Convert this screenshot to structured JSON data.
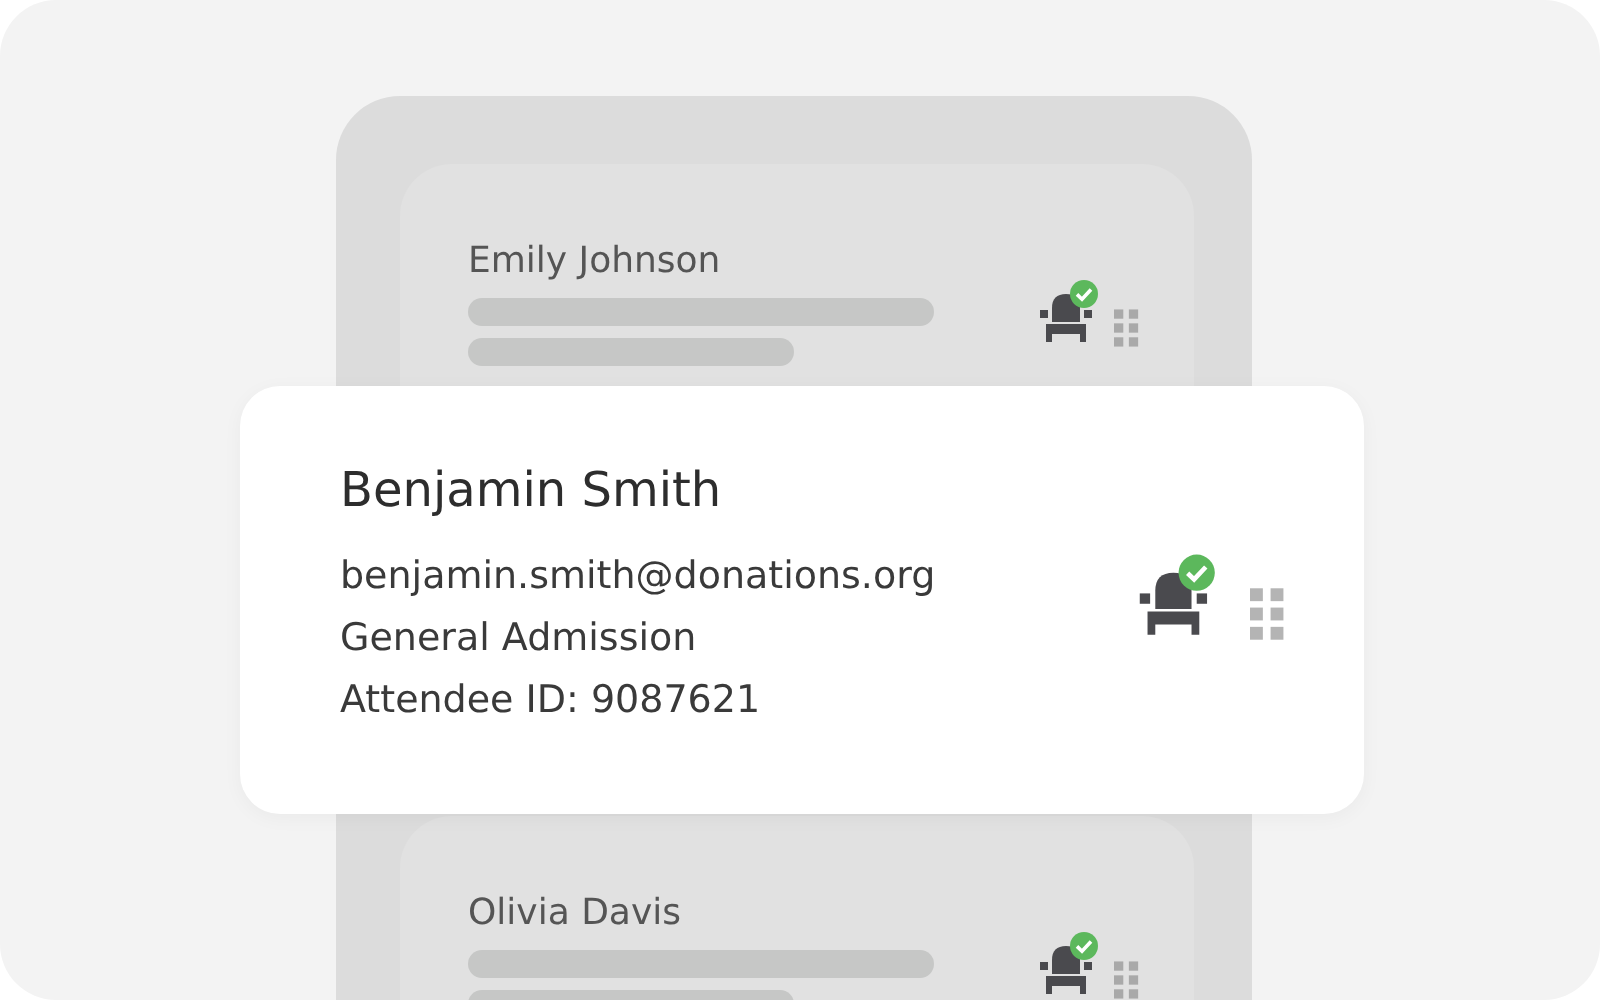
{
  "attendees": [
    {
      "name": "Emily Johnson",
      "checked_in": true
    },
    {
      "name": "Olivia Davis",
      "checked_in": true
    }
  ],
  "detail": {
    "name": "Benjamin Smith",
    "email": "benjamin.smith@donations.org",
    "ticket": "General Admission",
    "attendee_id": "Attendee ID: 9087621",
    "checked_in": true
  }
}
